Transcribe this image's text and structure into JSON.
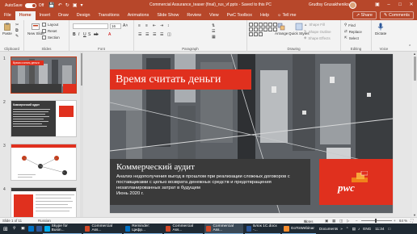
{
  "titlebar": {
    "autosave_label": "AutoSave",
    "autosave_state": "Off",
    "doc_title": "Commercial Assurance_teaser (final)_rus_vf.pptx  -  Saved to this PC",
    "user": "Grudtsy Grusakheniko",
    "colors": {
      "brand": "#b7472a"
    }
  },
  "tabs": [
    "File",
    "Home",
    "Insert",
    "Draw",
    "Design",
    "Transitions",
    "Animations",
    "Slide Show",
    "Review",
    "View",
    "PwC Toolbox",
    "Help"
  ],
  "active_tab": "Home",
  "tell_me": "Tell me",
  "share_label": "Share",
  "comments_label": "Comments",
  "ribbon": {
    "clipboard": {
      "paste": "Paste",
      "label": "Clipboard"
    },
    "slides": {
      "new_slide": "New Slide",
      "layout": "Layout",
      "reset": "Reset",
      "section": "Section",
      "label": "Slides"
    },
    "font": {
      "size": "16",
      "label": "Font"
    },
    "paragraph": {
      "label": "Paragraph"
    },
    "drawing": {
      "arrange": "Arrange",
      "quick_styles": "Quick Styles",
      "shape_fill": "Shape Fill",
      "shape_outline": "Shape Outline",
      "shape_effects": "Shape Effects",
      "label": "Drawing"
    },
    "editing": {
      "find": "Find",
      "replace": "Replace",
      "select": "Select",
      "label": "Editing"
    },
    "voice": {
      "dictate": "Dictate",
      "label": "Voice"
    }
  },
  "thumbnails": [
    {
      "num": "1",
      "title": "Время считать деньги"
    },
    {
      "num": "2",
      "title": "Коммерческий аудит"
    },
    {
      "num": "3",
      "title": ""
    },
    {
      "num": "4",
      "title": ""
    }
  ],
  "slide": {
    "title": "Время считать деньги",
    "heading": "Коммерческий аудит",
    "body": "Анализ недополучения выгод в прошлом при реализации сложных договоров с поставщиками с целью возврата денежных средств и предотвращения незапланированных затрат в будущем",
    "date": "Июнь 2020 г.",
    "logo": "pwc",
    "colors": {
      "accent": "#e0301e",
      "dark": "#3a3a3a"
    }
  },
  "statusbar": {
    "slide_count": "Slide 1 of 11",
    "language": "Russian",
    "notes": "Notes",
    "zoom": "64 %"
  },
  "taskbar": {
    "items": [
      "Skype for Busin...",
      "Commercial Ass...",
      "Reminder: Цифр...",
      "Commercial Ass...",
      "Commercial Ass...",
      "Блок 1С.docx -...",
      "GoToWebinar"
    ],
    "tray_label": "Documents",
    "lang": "ENG",
    "time": "11:34"
  }
}
